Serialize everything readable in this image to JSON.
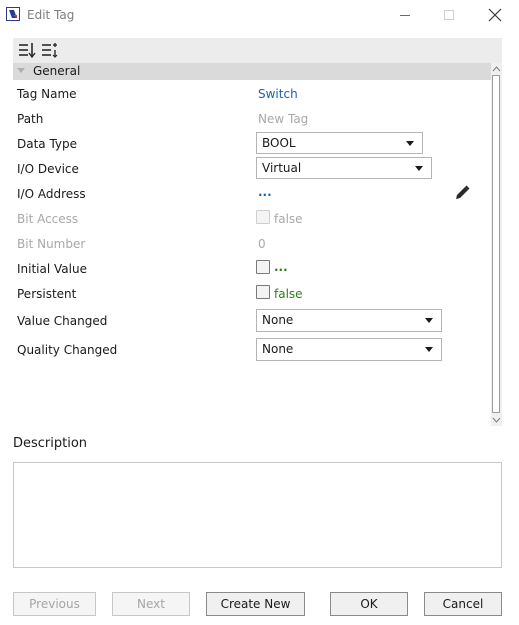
{
  "window": {
    "title": "Edit Tag"
  },
  "toolbar": {
    "sort_icon": "sort-order-icon",
    "category_icon": "categorized-sort-icon"
  },
  "section": {
    "label": "General"
  },
  "properties": {
    "tag_name": {
      "label": "Tag Name",
      "value": "Switch"
    },
    "path": {
      "label": "Path",
      "value": "New Tag"
    },
    "data_type": {
      "label": "Data Type",
      "value": "BOOL"
    },
    "io_device": {
      "label": "I/O Device",
      "value": "Virtual"
    },
    "io_address": {
      "label": "I/O Address",
      "value": "..."
    },
    "bit_access": {
      "label": "Bit Access",
      "value": "false"
    },
    "bit_number": {
      "label": "Bit Number",
      "value": "0"
    },
    "initial_value": {
      "label": "Initial Value",
      "value": "..."
    },
    "persistent": {
      "label": "Persistent",
      "value": "false"
    },
    "value_changed": {
      "label": "Value Changed",
      "value": "None"
    },
    "quality_changed": {
      "label": "Quality Changed",
      "value": "None"
    }
  },
  "description": {
    "label": "Description",
    "value": ""
  },
  "buttons": {
    "previous": "Previous",
    "next": "Next",
    "create_new": "Create New",
    "ok": "OK",
    "cancel": "Cancel"
  },
  "colors": {
    "link": "#1c62b4",
    "value_green": "#2f7d16",
    "disabled": "#a8a8a8"
  }
}
